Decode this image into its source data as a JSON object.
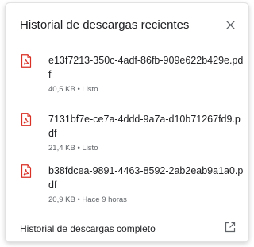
{
  "header": {
    "title": "Historial de descargas recientes",
    "close_icon": "close-icon"
  },
  "downloads": [
    {
      "icon": "pdf-file-icon",
      "file_name": "e13f7213-350c-4adf-86fb-909e622b429e.pdf",
      "meta": "40,5 KB • Listo"
    },
    {
      "icon": "pdf-file-icon",
      "file_name": "7131bf7e-ce7a-4ddd-9a7a-d10b71267fd9.pdf",
      "meta": "21,4 KB • Listo"
    },
    {
      "icon": "pdf-file-icon",
      "file_name": "b38fdcea-9891-4463-8592-2ab2eab9a1a0.pdf",
      "meta": "20,9 KB • Hace 9 horas"
    }
  ],
  "footer": {
    "label": "Historial de descargas completo",
    "icon": "open-in-new-icon"
  },
  "colors": {
    "pdf_red": "#d93025",
    "text": "#202124",
    "secondary_text": "#5f6368"
  }
}
